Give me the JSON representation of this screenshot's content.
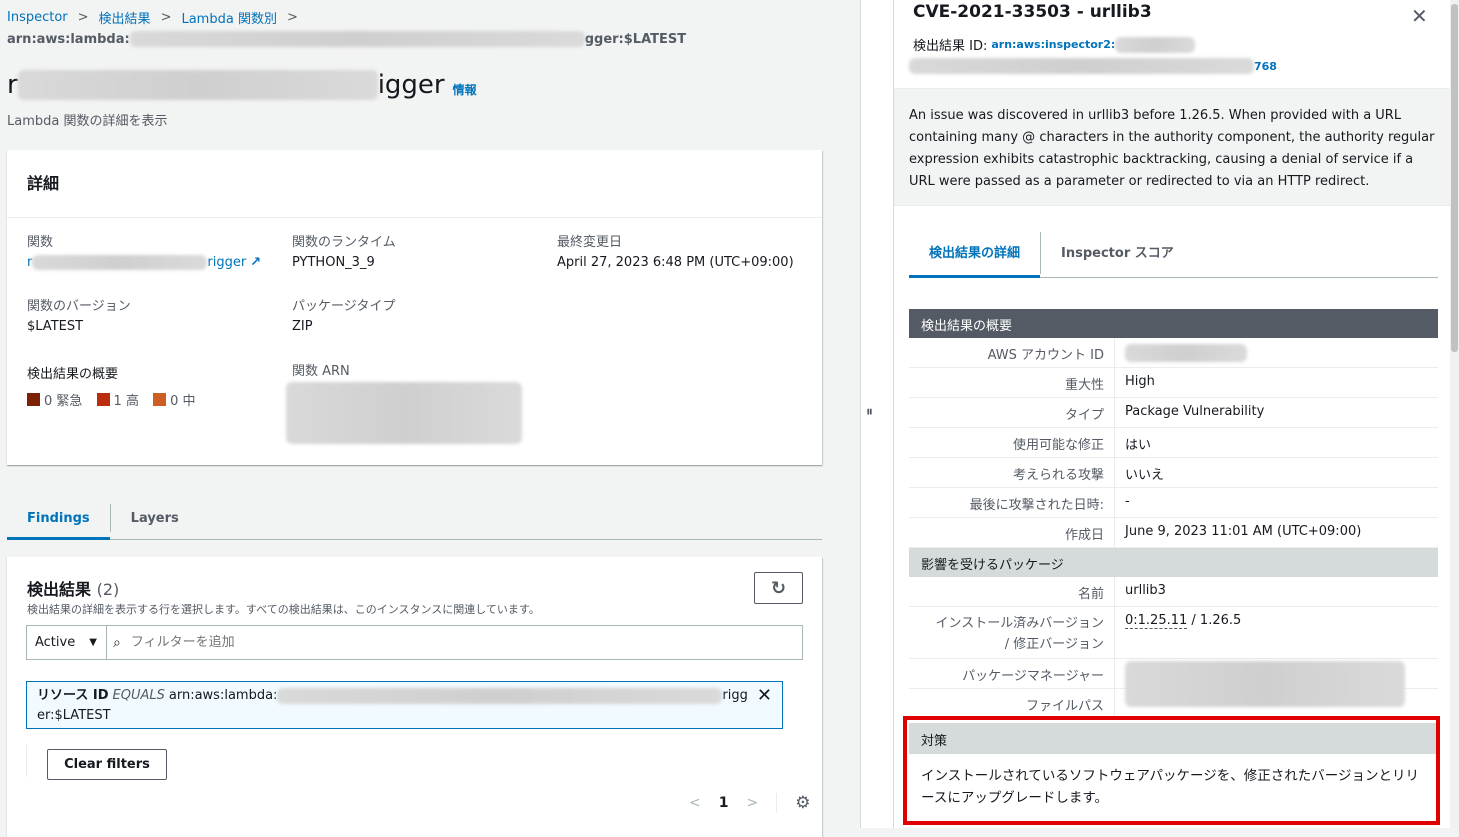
{
  "breadcrumb": [
    "Inspector",
    "検出結果",
    "Lambda 関数別"
  ],
  "arn_prefix": "arn:aws:lambda:",
  "arn_suffix": "gger:$LATEST",
  "page_title_prefix": "r",
  "page_title_suffix": "igger",
  "info_link": "情報",
  "subtitle": "Lambda 関数の詳細を表示",
  "details": {
    "header": "詳細",
    "function_label": "関数",
    "function_value_prefix": "r",
    "function_value_suffix": "rigger",
    "runtime_label": "関数のランタイム",
    "runtime_value": "PYTHON_3_9",
    "modified_label": "最終変更日",
    "modified_value": "April 27, 2023 6:48 PM (UTC+09:00)",
    "version_label": "関数のバージョン",
    "version_value": "$LATEST",
    "package_type_label": "パッケージタイプ",
    "package_type_value": "ZIP",
    "summary_label": "検出結果の概要",
    "critical": "0 緊急",
    "high": "1 高",
    "medium": "0 中",
    "arn_label": "関数 ARN"
  },
  "colors": {
    "critical": "#7d2105",
    "high": "#ba2e0f",
    "medium": "#cc5f21",
    "accent": "#0073bb",
    "highlight": "#e00000"
  },
  "tabs": [
    "Findings",
    "Layers"
  ],
  "findings": {
    "title": "検出結果",
    "count": "(2)",
    "description": "検出結果の詳細を表示する行を選択します。すべての検出結果は、このインスタンスに関連しています。",
    "status_select": "Active",
    "filter_placeholder": "フィルターを追加",
    "token_key": "リソース ID",
    "token_op": "EQUALS",
    "token_val_prefix": "arn:aws:lambda:",
    "token_val_suffix": "rigg",
    "token_val_line2": "er:$LATEST",
    "clear_filters": "Clear filters",
    "page": "1"
  },
  "panel": {
    "title": "CVE-2021-33503 - urllib3",
    "id_label": "検出結果 ID:",
    "id_prefix": "arn:aws:inspector2:",
    "id_suffix": "768",
    "description": "An issue was discovered in urllib3 before 1.26.5. When provided with a URL containing many @ characters in the authority component, the authority regular expression exhibits catastrophic backtracking, causing a denial of service if a URL were passed as a parameter or redirected to via an HTTP redirect.",
    "tabs": [
      "検出結果の詳細",
      "Inspector スコア"
    ],
    "overview_header": "検出結果の概要",
    "rows": [
      {
        "k": "AWS アカウント ID",
        "v": ""
      },
      {
        "k": "重大性",
        "v": "High"
      },
      {
        "k": "タイプ",
        "v": "Package Vulnerability"
      },
      {
        "k": "使用可能な修正",
        "v": "はい"
      },
      {
        "k": "考えられる攻撃",
        "v": "いいえ"
      },
      {
        "k": "最後に攻撃された日時:",
        "v": "-"
      },
      {
        "k": "作成日",
        "v": "June 9, 2023 11:01 AM (UTC+09:00)"
      }
    ],
    "package_header": "影響を受けるパッケージ",
    "pkg_name_label": "名前",
    "pkg_name": "urllib3",
    "pkg_version_label_1": "インストール済みバージョン",
    "pkg_version_label_2": "/ 修正バージョン",
    "pkg_installed": "0:1.25.11",
    "pkg_fixed": "/ 1.26.5",
    "pkg_manager_label": "パッケージマネージャー",
    "file_path_label": "ファイルパス",
    "remediation_header": "対策",
    "remediation_text": "インストールされているソフトウェアパッケージを、修正されたバージョンとリリースにアップグレードします。"
  }
}
